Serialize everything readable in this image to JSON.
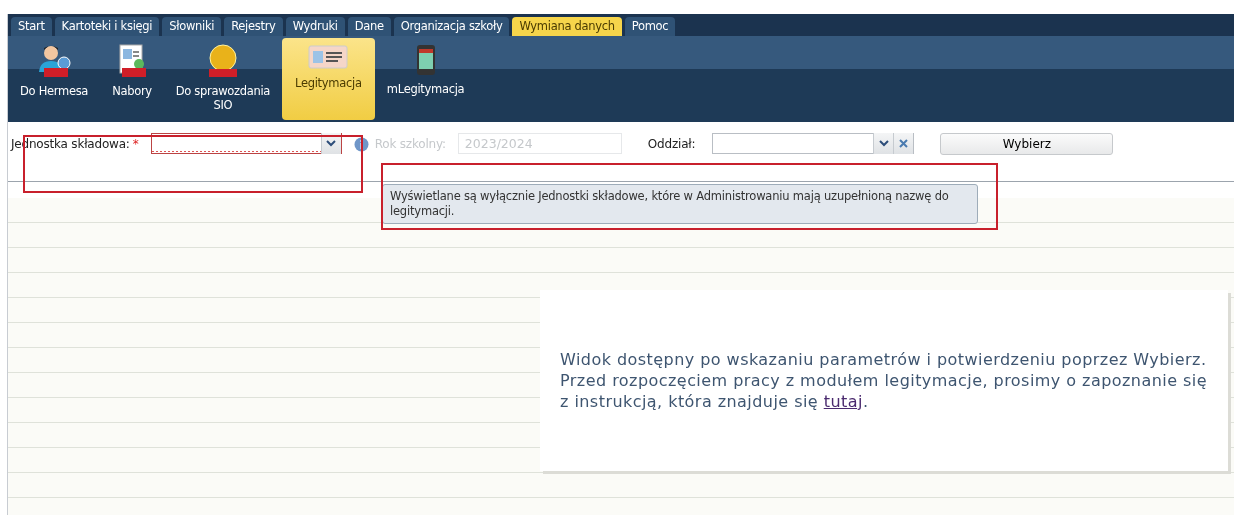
{
  "menu_tabs": [
    {
      "label": "Start",
      "selected": false
    },
    {
      "label": "Kartoteki i księgi",
      "selected": false
    },
    {
      "label": "Słowniki",
      "selected": false
    },
    {
      "label": "Rejestry",
      "selected": false
    },
    {
      "label": "Wydruki",
      "selected": false
    },
    {
      "label": "Dane",
      "selected": false
    },
    {
      "label": "Organizacja szkoły",
      "selected": false
    },
    {
      "label": "Wymiana danych",
      "selected": true
    },
    {
      "label": "Pomoc",
      "selected": false
    }
  ],
  "toolbar": [
    {
      "label": "Do Hermesa",
      "kind": "person-pdf",
      "selected": false
    },
    {
      "label": "Nabory",
      "kind": "document-pdf",
      "selected": false
    },
    {
      "label": "Do sprawozdania SIO",
      "kind": "sio-pdf",
      "selected": false
    },
    {
      "label": "Legitymacja",
      "kind": "id-card",
      "selected": true
    },
    {
      "label": "mLegitymacja",
      "kind": "phone",
      "selected": false
    }
  ],
  "filters": {
    "unit": {
      "label": "Jednostka składowa:",
      "required_mark": "*",
      "invalid": true,
      "highlighted": true
    },
    "school_year": {
      "label": "Rok szkolny:",
      "value": "2023/2024",
      "disabled": true
    },
    "class": {
      "label": "Oddział:"
    },
    "submit": "Wybierz"
  },
  "tooltip": {
    "text": "Wyświetlane są wyłącznie Jednostki składowe, które w Administrowaniu mają uzupełnioną nazwę do legitymacji.",
    "highlighted": true
  },
  "message": {
    "text": "Widok dostępny po wskazaniu parametrów i potwierdzeniu poprzez Wybierz. Przed rozpoczęciem pracy z modułem legitymacje, prosimy o zapoznanie się z instrukcją, która znajduje się",
    "link": "tutaj",
    "after": "."
  }
}
